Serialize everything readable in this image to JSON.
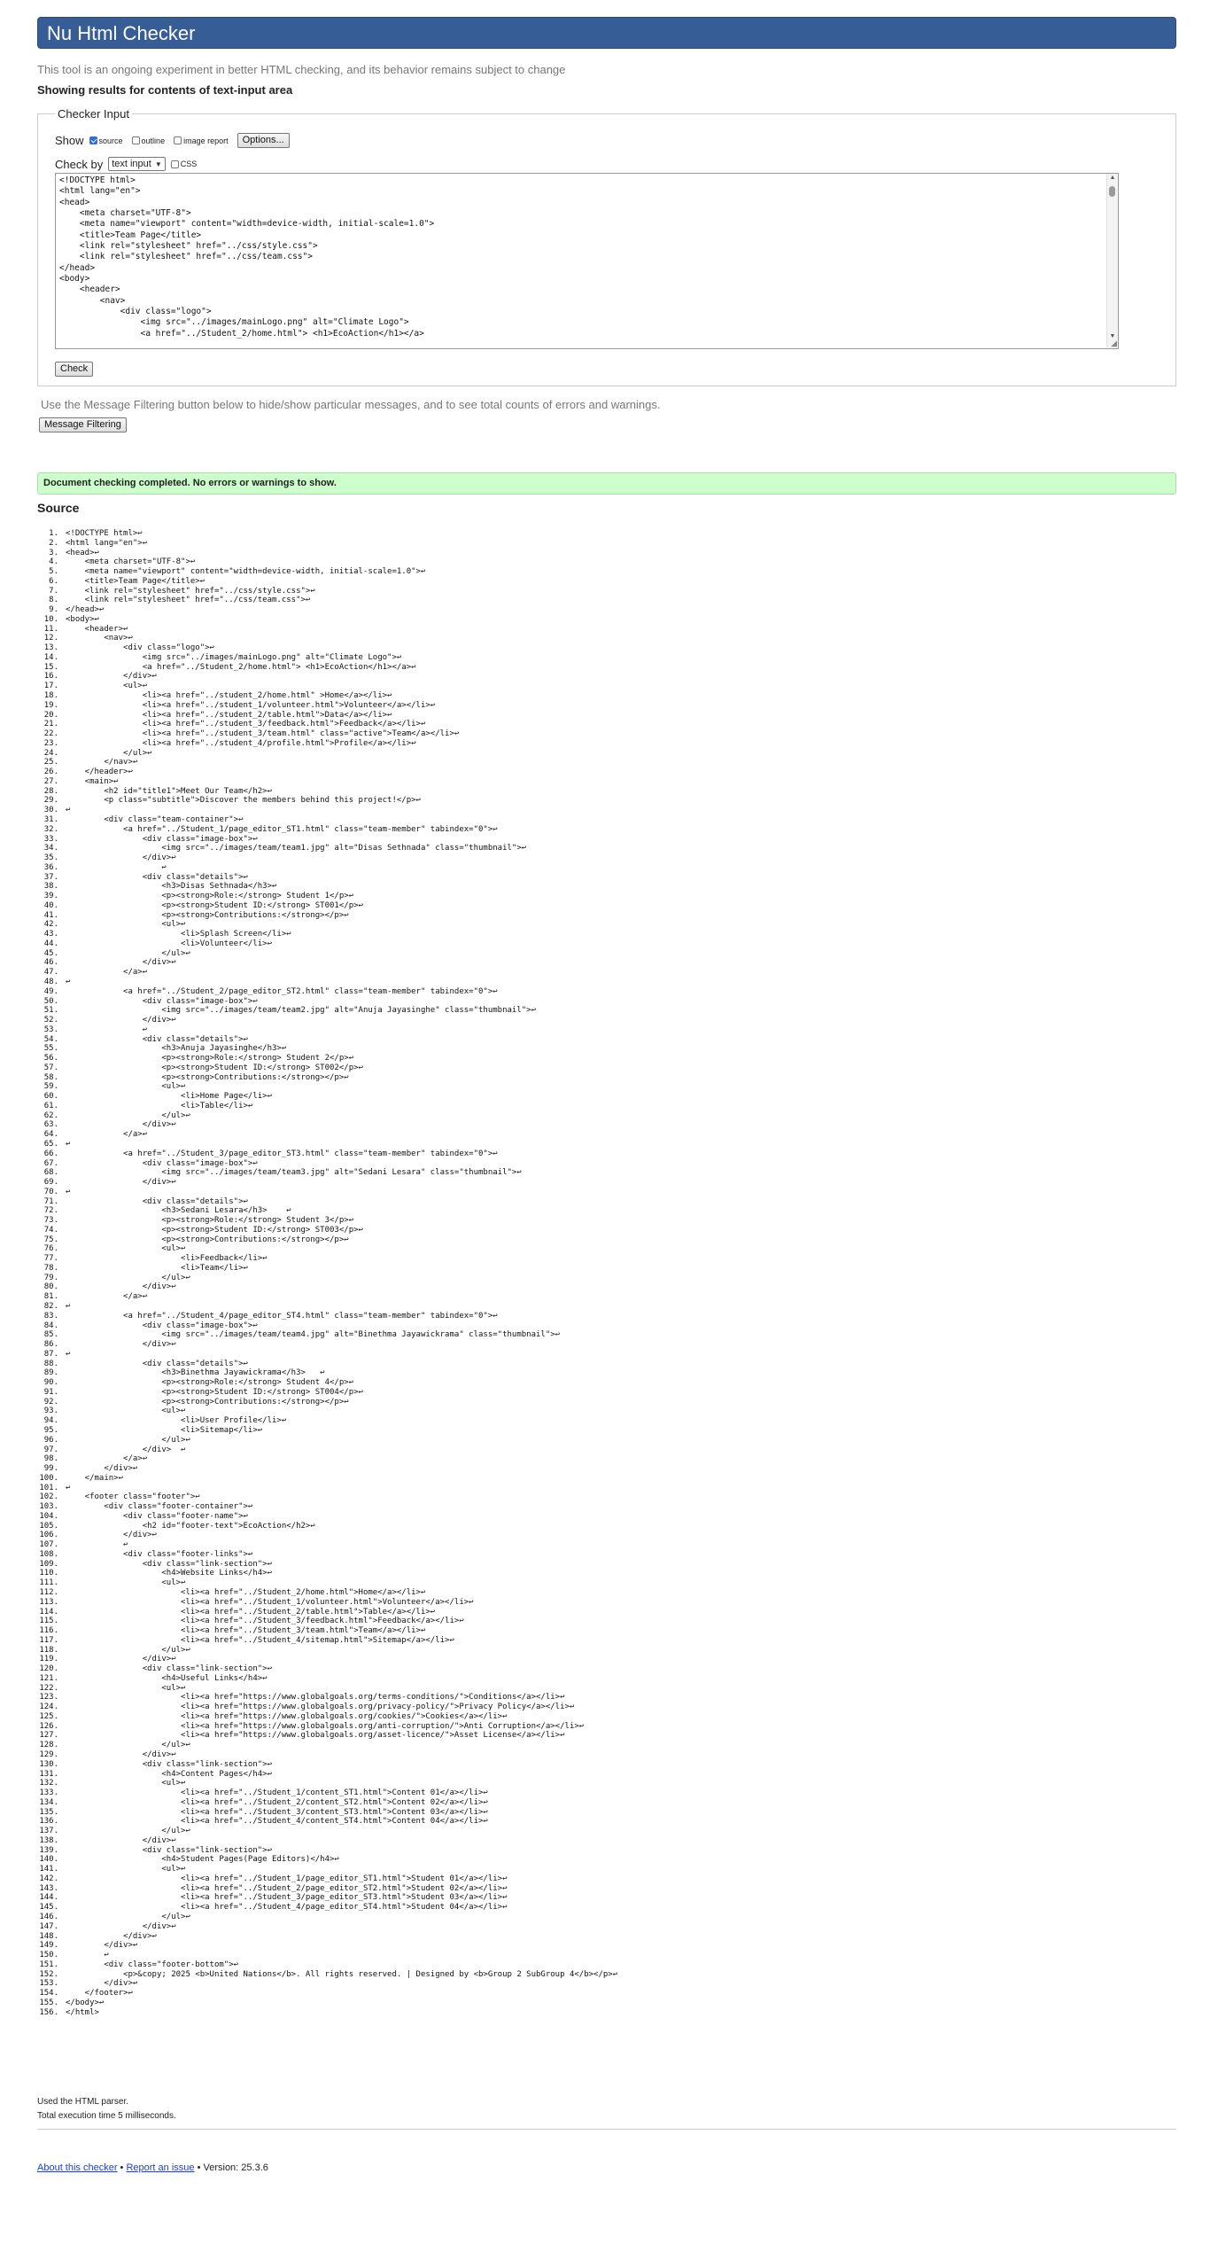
{
  "header": {
    "title": "Nu Html Checker"
  },
  "tagline": "This tool is an ongoing experiment in better HTML checking, and its behavior remains subject to change",
  "showing": "Showing results for contents of text-input area",
  "checker_input": {
    "legend": "Checker Input",
    "show_label": "Show",
    "options": [
      {
        "label": "source",
        "checked": true
      },
      {
        "label": "outline",
        "checked": false
      },
      {
        "label": "image report",
        "checked": false
      }
    ],
    "options_button": "Options...",
    "check_by_label": "Check by",
    "check_by_value": "text input",
    "css_label": "CSS",
    "textarea_content": "<!DOCTYPE html>\n<html lang=\"en\">\n<head>\n    <meta charset=\"UTF-8\">\n    <meta name=\"viewport\" content=\"width=device-width, initial-scale=1.0\">\n    <title>Team Page</title>\n    <link rel=\"stylesheet\" href=\"../css/style.css\">\n    <link rel=\"stylesheet\" href=\"../css/team.css\">\n</head>\n<body>\n    <header>\n        <nav>\n            <div class=\"logo\">\n                <img src=\"../images/mainLogo.png\" alt=\"Climate Logo\">\n                <a href=\"../Student_2/home.html\"> <h1>EcoAction</h1></a>",
    "check_button": "Check"
  },
  "filter": {
    "text": "Use the Message Filtering button below to hide/show particular messages, and to see total counts of errors and warnings.",
    "button": "Message Filtering"
  },
  "result": {
    "message": "Document checking completed. No errors or warnings to show."
  },
  "source": {
    "heading": "Source",
    "return_glyph": "↩",
    "lines": [
      "<!DOCTYPE html>↩",
      "<html lang=\"en\">↩",
      "<head>↩",
      "    <meta charset=\"UTF-8\">↩",
      "    <meta name=\"viewport\" content=\"width=device-width, initial-scale=1.0\">↩",
      "    <title>Team Page</title>↩",
      "    <link rel=\"stylesheet\" href=\"../css/style.css\">↩",
      "    <link rel=\"stylesheet\" href=\"../css/team.css\">↩",
      "</head>↩",
      "<body>↩",
      "    <header>↩",
      "        <nav>↩",
      "            <div class=\"logo\">↩",
      "                <img src=\"../images/mainLogo.png\" alt=\"Climate Logo\">↩",
      "                <a href=\"../Student_2/home.html\"> <h1>EcoAction</h1></a>↩",
      "            </div>↩",
      "            <ul>↩",
      "                <li><a href=\"../student_2/home.html\" >Home</a></li>↩",
      "                <li><a href=\"../student_1/volunteer.html\">Volunteer</a></li>↩",
      "                <li><a href=\"../student_2/table.html\">Data</a></li>↩",
      "                <li><a href=\"../student_3/feedback.html\">Feedback</a></li>↩",
      "                <li><a href=\"../student_3/team.html\" class=\"active\">Team</a></li>↩",
      "                <li><a href=\"../student_4/profile.html\">Profile</a></li>↩",
      "            </ul>↩",
      "        </nav>↩",
      "    </header>↩",
      "    <main>↩",
      "        <h2 id=\"title1\">Meet Our Team</h2>↩",
      "        <p class=\"subtitle\">Discover the members behind this project!</p>↩",
      "↩",
      "        <div class=\"team-container\">↩",
      "            <a href=\"../Student_1/page_editor_ST1.html\" class=\"team-member\" tabindex=\"0\">↩",
      "                <div class=\"image-box\">↩",
      "                    <img src=\"../images/team/team1.jpg\" alt=\"Disas Sethnada\" class=\"thumbnail\">↩",
      "                </div>↩",
      "                    ↩",
      "                <div class=\"details\">↩",
      "                    <h3>Disas Sethnada</h3>↩",
      "                    <p><strong>Role:</strong> Student 1</p>↩",
      "                    <p><strong>Student ID:</strong> ST001</p>↩",
      "                    <p><strong>Contributions:</strong></p>↩",
      "                    <ul>↩",
      "                        <li>Splash Screen</li>↩",
      "                        <li>Volunteer</li>↩",
      "                    </ul>↩",
      "                </div>↩",
      "            </a>↩",
      "↩",
      "            <a href=\"../Student_2/page_editor_ST2.html\" class=\"team-member\" tabindex=\"0\">↩",
      "                <div class=\"image-box\">↩",
      "                    <img src=\"../images/team/team2.jpg\" alt=\"Anuja Jayasinghe\" class=\"thumbnail\">↩",
      "                </div>↩",
      "                ↩",
      "                <div class=\"details\">↩",
      "                    <h3>Anuja Jayasinghe</h3>↩",
      "                    <p><strong>Role:</strong> Student 2</p>↩",
      "                    <p><strong>Student ID:</strong> ST002</p>↩",
      "                    <p><strong>Contributions:</strong></p>↩",
      "                    <ul>↩",
      "                        <li>Home Page</li>↩",
      "                        <li>Table</li>↩",
      "                    </ul>↩",
      "                </div>↩",
      "            </a>↩",
      "↩",
      "            <a href=\"../Student_3/page_editor_ST3.html\" class=\"team-member\" tabindex=\"0\">↩",
      "                <div class=\"image-box\">↩",
      "                    <img src=\"../images/team/team3.jpg\" alt=\"Sedani Lesara\" class=\"thumbnail\">↩",
      "                </div>↩",
      "↩",
      "                <div class=\"details\">↩",
      "                    <h3>Sedani Lesara</h3>    ↩",
      "                    <p><strong>Role:</strong> Student 3</p>↩",
      "                    <p><strong>Student ID:</strong> ST003</p>↩",
      "                    <p><strong>Contributions:</strong></p>↩",
      "                    <ul>↩",
      "                        <li>Feedback</li>↩",
      "                        <li>Team</li>↩",
      "                    </ul>↩",
      "                </div>↩",
      "            </a>↩",
      "↩",
      "            <a href=\"../Student_4/page_editor_ST4.html\" class=\"team-member\" tabindex=\"0\">↩",
      "                <div class=\"image-box\">↩",
      "                    <img src=\"../images/team/team4.jpg\" alt=\"Binethma Jayawickrama\" class=\"thumbnail\">↩",
      "                </div>↩",
      "↩",
      "                <div class=\"details\">↩",
      "                    <h3>Binethma Jayawickrama</h3>   ↩",
      "                    <p><strong>Role:</strong> Student 4</p>↩",
      "                    <p><strong>Student ID:</strong> ST004</p>↩",
      "                    <p><strong>Contributions:</strong></p>↩",
      "                    <ul>↩",
      "                        <li>User Profile</li>↩",
      "                        <li>Sitemap</li>↩",
      "                    </ul>↩",
      "                </div>  ↩",
      "            </a>↩",
      "        </div>↩",
      "    </main>↩",
      "↩",
      "    <footer class=\"footer\">↩",
      "        <div class=\"footer-container\">↩",
      "            <div class=\"footer-name\">↩",
      "                <h2 id=\"footer-text\">EcoAction</h2>↩",
      "            </div>↩",
      "            ↩",
      "            <div class=\"footer-links\">↩",
      "                <div class=\"link-section\">↩",
      "                    <h4>Website Links</h4>↩",
      "                    <ul>↩",
      "                        <li><a href=\"../Student_2/home.html\">Home</a></li>↩",
      "                        <li><a href=\"../Student_1/volunteer.html\">Volunteer</a></li>↩",
      "                        <li><a href=\"../Student_2/table.html\">Table</a></li>↩",
      "                        <li><a href=\"../Student_3/feedback.html\">Feedback</a></li>↩",
      "                        <li><a href=\"../Student_3/team.html\">Team</a></li>↩",
      "                        <li><a href=\"../Student_4/sitemap.html\">Sitemap</a></li>↩",
      "                    </ul>↩",
      "                </div>↩",
      "                <div class=\"link-section\">↩",
      "                    <h4>Useful Links</h4>↩",
      "                    <ul>↩",
      "                        <li><a href=\"https://www.globalgoals.org/terms-conditions/\">Conditions</a></li>↩",
      "                        <li><a href=\"https://www.globalgoals.org/privacy-policy/\">Privacy Policy</a></li>↩",
      "                        <li><a href=\"https://www.globalgoals.org/cookies/\">Cookies</a></li>↩",
      "                        <li><a href=\"https://www.globalgoals.org/anti-corruption/\">Anti Corruption</a></li>↩",
      "                        <li><a href=\"https://www.globalgoals.org/asset-licence/\">Asset License</a></li>↩",
      "                    </ul>↩",
      "                </div>↩",
      "                <div class=\"link-section\">↩",
      "                    <h4>Content Pages</h4>↩",
      "                    <ul>↩",
      "                        <li><a href=\"../Student_1/content_ST1.html\">Content 01</a></li>↩",
      "                        <li><a href=\"../Student_2/content_ST2.html\">Content 02</a></li>↩",
      "                        <li><a href=\"../Student_3/content_ST3.html\">Content 03</a></li>↩",
      "                        <li><a href=\"../Student_4/content_ST4.html\">Content 04</a></li>↩",
      "                    </ul>↩",
      "                </div>↩",
      "                <div class=\"link-section\">↩",
      "                    <h4>Student Pages(Page Editors)</h4>↩",
      "                    <ul>↩",
      "                        <li><a href=\"../Student_1/page_editor_ST1.html\">Student 01</a></li>↩",
      "                        <li><a href=\"../Student_2/page_editor_ST2.html\">Student 02</a></li>↩",
      "                        <li><a href=\"../Student_3/page_editor_ST3.html\">Student 03</a></li>↩",
      "                        <li><a href=\"../Student_4/page_editor_ST4.html\">Student 04</a></li>↩",
      "                    </ul>↩",
      "                </div>↩",
      "            </div>↩",
      "        </div>↩",
      "        ↩",
      "        <div class=\"footer-bottom\">↩",
      "            <p>&copy; 2025 <b>United Nations</b>. All rights reserved. | Designed by <b>Group 2 SubGroup 4</b></p>↩",
      "        </div>↩",
      "    </footer>↩",
      "</body>↩",
      "</html>"
    ]
  },
  "parser_note": "Used the HTML parser.",
  "execution_note": "Total execution time 5 milliseconds.",
  "footer": {
    "about": "About this checker",
    "separator": " • ",
    "report": "Report an issue",
    "version": "Version: 25.3.6"
  },
  "colors": {
    "header_bg": "#365d95",
    "success_bg": "#ccffcc",
    "link": "#1a3fd6"
  }
}
